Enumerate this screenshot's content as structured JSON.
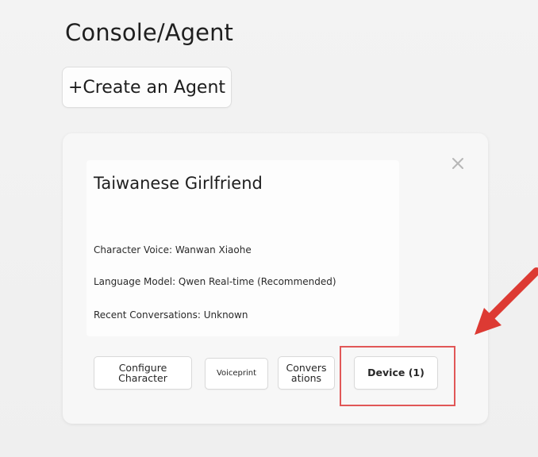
{
  "page": {
    "title": "Console/Agent",
    "create_button_label": "+Create an Agent"
  },
  "agent_card": {
    "name": "Taiwanese Girlfriend",
    "close_icon": "close-icon",
    "details": [
      "Character Voice: Wanwan Xiaohe",
      "Language Model: Qwen Real-time (Recommended)",
      "Recent Conversations: Unknown"
    ],
    "actions": {
      "configure_character": "Configure\nCharacter",
      "voiceprint": "Voiceprint",
      "conversations": "Convers\nations",
      "device": "Device (1)"
    }
  },
  "annotation": {
    "arrow_icon": "red-arrow-icon",
    "highlight_color": "#e15757"
  }
}
